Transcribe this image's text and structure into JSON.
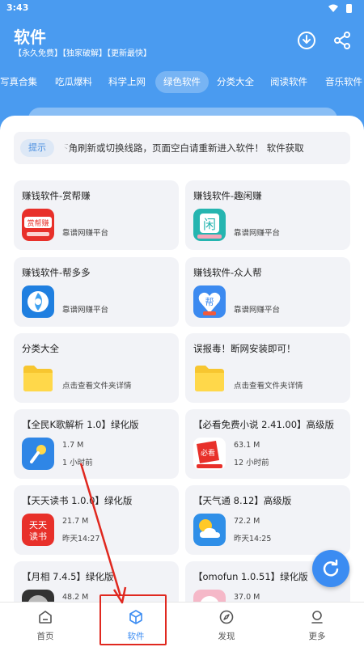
{
  "status": {
    "time": "3:43"
  },
  "header": {
    "title": "软件",
    "subtitle": "【永久免费】【独家破解】【更新最快】",
    "download_icon": "download-icon",
    "share_icon": "share-icon"
  },
  "tabs": [
    {
      "label": "写真合集"
    },
    {
      "label": "吃瓜爆料"
    },
    {
      "label": "科学上网"
    },
    {
      "label": "绿色软件"
    },
    {
      "label": "分类大全"
    },
    {
      "label": "阅读软件"
    },
    {
      "label": "音乐软件"
    }
  ],
  "notice": {
    "tag": "提示",
    "text": "请点击右下角刷新或切换线路，页面空白请重新进入软件！  软件获取"
  },
  "cards": [
    {
      "title": "赚钱软件-赏帮赚",
      "desc": "靠谱网赚平台",
      "icon": "shangbangzhuan-app-icon"
    },
    {
      "title": "赚钱软件-趣闲赚",
      "desc": "靠谱网赚平台",
      "icon": "quxianzhuan-app-icon"
    },
    {
      "title": "赚钱软件-帮多多",
      "desc": "靠谱网赚平台",
      "icon": "bangduoduo-app-icon"
    },
    {
      "title": "赚钱软件-众人帮",
      "desc": "靠谱网赚平台",
      "icon": "zhongrenbang-app-icon"
    },
    {
      "title": "分类大全",
      "desc": "点击查看文件夹详情",
      "icon": "folder-icon"
    },
    {
      "title": "误报毒！断网安装即可！",
      "desc": "点击查看文件夹详情",
      "icon": "folder-icon"
    },
    {
      "title": "【全民K歌解析 1.0】绿化版",
      "size": "1.7 M",
      "time": "1 小时前",
      "icon": "microphone-app-icon"
    },
    {
      "title": "【必看免费小说 2.41.00】高级版",
      "size": "63.1 M",
      "time": "12 小时前",
      "icon": "novel-app-icon"
    },
    {
      "title": "【天天读书 1.0.0】绿化版",
      "size": "21.7 M",
      "time": "昨天14:27",
      "icon": "tiantiandushu-app-icon"
    },
    {
      "title": "【天气通 8.12】高级版",
      "size": "72.2 M",
      "time": "昨天14:25",
      "icon": "weather-app-icon"
    },
    {
      "title": "【月相 7.4.5】绿化版",
      "size": "48.2 M",
      "time": "",
      "icon": "moon-app-icon"
    },
    {
      "title": "【omofun 1.0.51】绿化版",
      "size": "37.0 M",
      "time": "",
      "icon": "omofun-app-icon"
    }
  ],
  "bottom_nav": [
    {
      "label": "首页",
      "icon": "home-icon"
    },
    {
      "label": "软件",
      "icon": "cube-icon"
    },
    {
      "label": "发现",
      "icon": "compass-icon"
    },
    {
      "label": "更多",
      "icon": "user-icon"
    }
  ],
  "colors": {
    "primary": "#4a9bf0",
    "accent": "#3b8cf2",
    "card_bg": "#f2f3f7",
    "highlight": "#e0281f"
  }
}
